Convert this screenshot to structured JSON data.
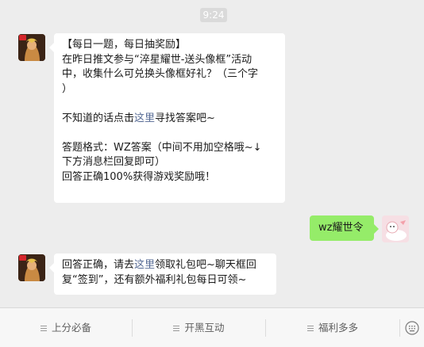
{
  "timestamp": "9:24",
  "messages": [
    {
      "sender": "game",
      "lines": [
        [
          "【每日一题，每日抽奖励】"
        ],
        [
          "在昨日推文参与“淬星耀世-送头像框”活动"
        ],
        [
          "中，收集什么可兑换头像框好礼？（三个字"
        ],
        [
          "）"
        ],
        [
          ""
        ],
        [
          "不知道的话点击",
          {
            "link": "这里"
          },
          "寻找答案吧~"
        ],
        [
          ""
        ],
        [
          "答题格式：WZ答案（中间不用加空格哦~↓"
        ],
        [
          "下方消息栏回复即可）"
        ],
        [
          "回答正确100%获得游戏奖励哦！"
        ]
      ]
    },
    {
      "sender": "user",
      "text": "wz耀世令"
    },
    {
      "sender": "game",
      "lines": [
        [
          "回答正确，请去",
          {
            "link": "这里"
          },
          "领取礼包吧~聊天框回"
        ],
        [
          "复“签到”，还有额外福利礼包每日可领~"
        ]
      ]
    }
  ],
  "menu": {
    "items": [
      "上分必备",
      "开黑互动",
      "福利多多"
    ],
    "keyboard_icon": "keyboard-icon"
  },
  "colors": {
    "link": "#576b95",
    "user_bubble": "#95ec69",
    "background": "#ededed"
  }
}
